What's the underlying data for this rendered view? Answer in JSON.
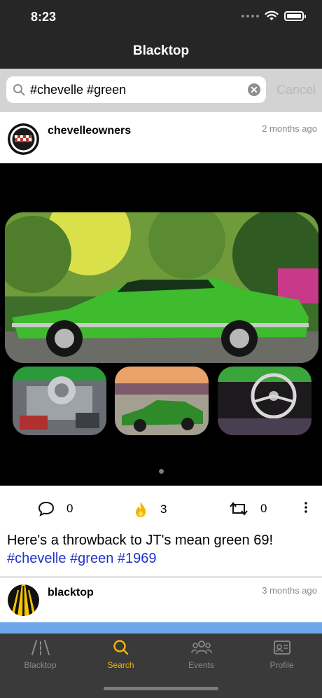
{
  "status_bar": {
    "time": "8:23"
  },
  "nav": {
    "title": "Blacktop"
  },
  "search": {
    "query": "#chevelle #green",
    "cancel_label": "Cancel"
  },
  "posts": [
    {
      "username": "chevelleowners",
      "time": "2 months ago",
      "comments": "0",
      "flames": "3",
      "reposts": "0",
      "caption": "Here's a throwback to JT's mean green 69!",
      "hashtags": "#chevelle #green #1969"
    },
    {
      "username": "blacktop",
      "time": "3 months ago"
    }
  ],
  "tabs": [
    {
      "label": "Blacktop",
      "icon": "road-icon",
      "active": false
    },
    {
      "label": "Search",
      "icon": "search-icon",
      "active": true
    },
    {
      "label": "Events",
      "icon": "people-icon",
      "active": false
    },
    {
      "label": "Profile",
      "icon": "id-card-icon",
      "active": false
    }
  ],
  "colors": {
    "active_tab": "#f0b400",
    "inactive_tab": "#8a8a8a",
    "hashtag": "#2233cc",
    "bar_bg": "#262626"
  }
}
